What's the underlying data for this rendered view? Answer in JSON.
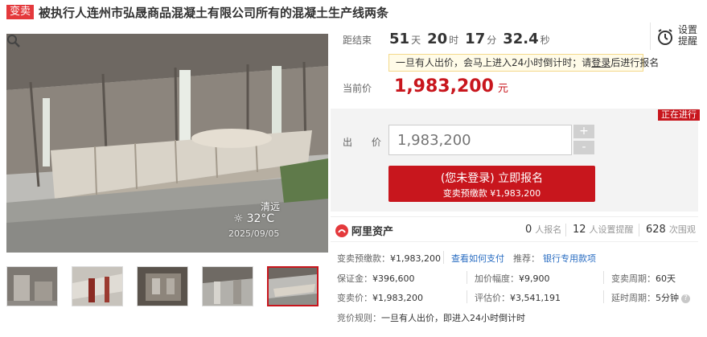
{
  "header": {
    "tag": "变卖",
    "title": "被执行人连州市弘晟商品混凝土有限公司所有的混凝土生产线两条"
  },
  "photo": {
    "watermark_place": "清远",
    "watermark_temp": "32°C",
    "watermark_date": "2025/09/05",
    "thumbnail_count": 5,
    "active_thumbnail": 5
  },
  "countdown": {
    "label": "距结束",
    "days": "51",
    "days_unit": "天",
    "hours": "20",
    "hours_unit": "时",
    "minutes": "17",
    "minutes_unit": "分",
    "seconds": "32.4",
    "seconds_unit": "秒"
  },
  "reminder": {
    "line1": "设置",
    "line2": "提醒"
  },
  "notice": {
    "text_before": "一旦有人出价，会马上进入24小时倒计时；请",
    "login_link": "登录",
    "text_after": "后进行报名"
  },
  "current_price": {
    "label": "当前价",
    "value": "1,983,200",
    "unit": "元"
  },
  "status": "正在进行",
  "bid": {
    "label": "出 价",
    "input_placeholder": "1,983,200",
    "plus": "+",
    "minus": "-",
    "register_line1": "(您未登录) 立即报名",
    "register_line2": "变卖预缴款 ¥1,983,200"
  },
  "stats": {
    "platform": "阿里资产",
    "signups": "0",
    "signups_unit": "人报名",
    "reminders": "12",
    "reminders_unit": "人设置提醒",
    "views": "628",
    "views_unit": "次围观"
  },
  "details": {
    "deposit_label": "变卖预缴款：",
    "deposit_value": "¥1,983,200",
    "how_to_pay": "查看如何支付",
    "recommend_label": "推荐：",
    "bank_link": "银行专用款项",
    "guarantee_label": "保证金：",
    "guarantee_value": "¥396,600",
    "increment_label": "加价幅度：",
    "increment_value": "¥9,900",
    "period_label": "变卖周期：",
    "period_value": "60天",
    "sale_price_label": "变卖价：",
    "sale_price_value": "¥1,983,200",
    "appraisal_label": "评估价：",
    "appraisal_value": "¥3,541,191",
    "delay_label": "延时周期：",
    "delay_value": "5分钟",
    "rule_label": "竞价规则：",
    "rule_value": "一旦有人出价，即进入24小时倒计时"
  },
  "colors": {
    "accent": "#c8161d",
    "link": "#2a6dc2",
    "notice_bg": "#fffbe8"
  }
}
